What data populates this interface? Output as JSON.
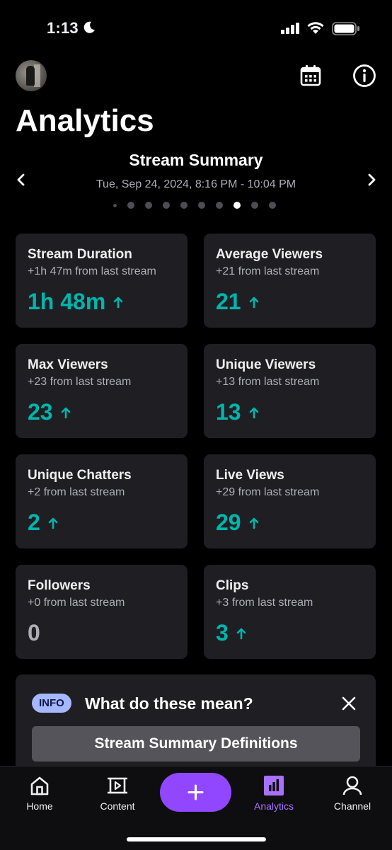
{
  "status_bar": {
    "time": "1:13",
    "icons": [
      "moon-icon",
      "signal-icon",
      "wifi-icon",
      "battery-icon"
    ]
  },
  "header": {
    "title": "Analytics",
    "icons": [
      "avatar",
      "calendar-icon",
      "info-icon"
    ]
  },
  "summary": {
    "title": "Stream Summary",
    "date_range": "Tue, Sep 24, 2024, 8:16 PM - 10:04 PM",
    "page_count": 10,
    "active_page_index": 7
  },
  "cards": [
    {
      "title": "Stream Duration",
      "sub": "+1h 47m from last stream",
      "value": "1h 48m",
      "trend": "up"
    },
    {
      "title": "Average Viewers",
      "sub": "+21 from last stream",
      "value": "21",
      "trend": "up"
    },
    {
      "title": "Max Viewers",
      "sub": "+23 from last stream",
      "value": "23",
      "trend": "up"
    },
    {
      "title": "Unique Viewers",
      "sub": "+13 from last stream",
      "value": "13",
      "trend": "up"
    },
    {
      "title": "Unique Chatters",
      "sub": "+2 from last stream",
      "value": "2",
      "trend": "up"
    },
    {
      "title": "Live Views",
      "sub": "+29 from last stream",
      "value": "29",
      "trend": "up"
    },
    {
      "title": "Followers",
      "sub": "+0 from last stream",
      "value": "0",
      "trend": "none"
    },
    {
      "title": "Clips",
      "sub": "+3 from last stream",
      "value": "3",
      "trend": "up"
    }
  ],
  "info_banner": {
    "badge": "INFO",
    "question": "What do these mean?",
    "button_label": "Stream Summary Definitions"
  },
  "bottom_nav": {
    "items": [
      {
        "label": "Home",
        "icon": "home-icon"
      },
      {
        "label": "Content",
        "icon": "content-icon"
      },
      {
        "label": "Analytics",
        "icon": "analytics-icon",
        "active": true
      },
      {
        "label": "Channel",
        "icon": "channel-icon"
      }
    ],
    "fab_icon": "plus-icon"
  },
  "colors": {
    "background": "#000000",
    "card": "#1f1f23",
    "accent_teal": "#00b5ad",
    "brand_purple": "#9147ff",
    "active_nav": "#a970ff",
    "info_badge": "#a5b8ff"
  }
}
